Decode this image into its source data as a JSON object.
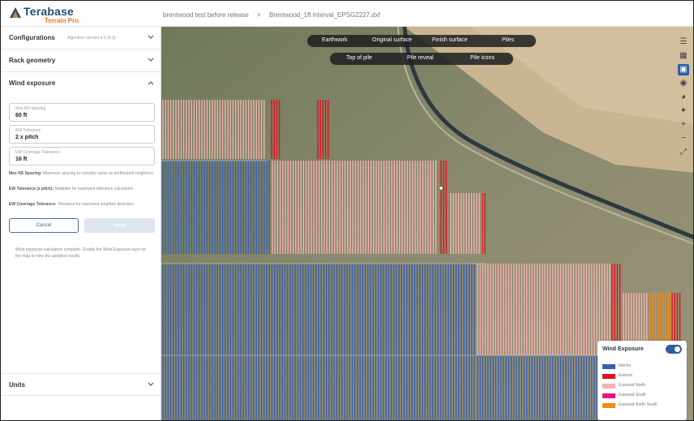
{
  "app": {
    "name": "Terabase",
    "subtitle": "Terrain Pro"
  },
  "breadcrumb": {
    "project": "brentwood test before release",
    "separator": ">",
    "file": "Brentwood_1ft interval_EPSG2227.dxf"
  },
  "sidebar": {
    "configurations": {
      "label": "Configurations",
      "version": "Algorithm Version 4.0 (4.0)"
    },
    "rack_geometry": {
      "label": "Rack geometry"
    },
    "wind_exposure": {
      "label": "Wind exposure",
      "fields": [
        {
          "label": "Max NS Spacing",
          "value": "60 ft"
        },
        {
          "label": "EW Tolerance",
          "value": "2 x pitch"
        },
        {
          "label": "EW Coverage Tolerance",
          "value": "16 ft"
        }
      ],
      "help": [
        {
          "term": "Max NS Spacing:",
          "text": "Maximum spacing to consider racks as north/south neighbors"
        },
        {
          "term": "EW Tolerance (x pitch):",
          "text": "Multiplier for east/west tolerance calculation"
        },
        {
          "term": "EW Coverage Tolerance:",
          "text": "Tolerance for east/west neighbor detection"
        }
      ],
      "cancel_label": "Cancel",
      "apply_label": "Apply",
      "status": "Wind exposure calculation complete. Enable the Wind Exposure layer on the map to view the updated results."
    },
    "units": {
      "label": "Units"
    }
  },
  "map": {
    "top_tabs": [
      "Earthwork",
      "Original surface",
      "Finish surface",
      "Piles"
    ],
    "sub_tabs": [
      "Top of pile",
      "Pile reveal",
      "Pile icons"
    ],
    "tools": [
      "layers-icon",
      "grid-icon",
      "map-view-icon",
      "camera-icon",
      "globe-icon",
      "compass-icon",
      "zoom-in-icon",
      "zoom-out-icon",
      "fullscreen-icon"
    ],
    "legend": {
      "title": "Wind Exposure",
      "toggle_on": true,
      "items": [
        {
          "label": "Interior",
          "color": "#3b5fa8"
        },
        {
          "label": "Exterior",
          "color": "#e3101e"
        },
        {
          "label": "Exposed North",
          "color": "#f4b3b3"
        },
        {
          "label": "Exposed South",
          "color": "#e0178a"
        },
        {
          "label": "Exposed North South",
          "color": "#f08c16"
        }
      ]
    }
  }
}
